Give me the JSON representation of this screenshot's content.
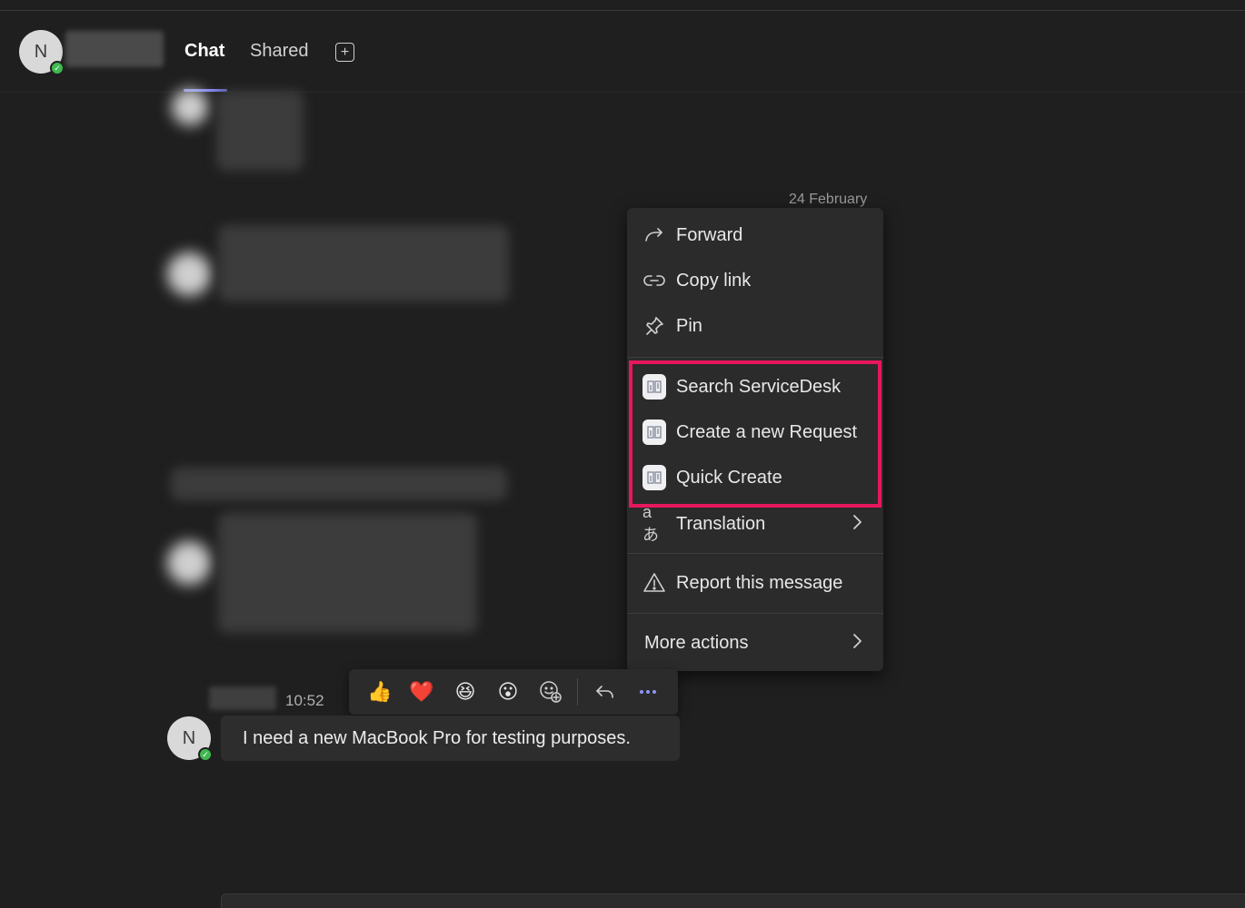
{
  "header": {
    "avatar_initial": "N",
    "tabs": [
      {
        "label": "Chat",
        "active": true
      },
      {
        "label": "Shared",
        "active": false
      }
    ],
    "add_tab_icon": "plus-square-icon"
  },
  "conversation": {
    "date_separator": "24 February",
    "message": {
      "avatar_initial": "N",
      "time": "10:52",
      "text": "I need a new MacBook Pro for testing purposes."
    }
  },
  "context_menu": {
    "items": [
      {
        "label": "Forward",
        "icon": "forward-arrow-icon"
      },
      {
        "label": "Copy link",
        "icon": "link-icon"
      },
      {
        "label": "Pin",
        "icon": "pin-icon"
      },
      {
        "label": "Search ServiceDesk",
        "icon": "servicedesk-app-icon"
      },
      {
        "label": "Create a new Request",
        "icon": "servicedesk-app-icon"
      },
      {
        "label": "Quick Create",
        "icon": "servicedesk-app-icon"
      },
      {
        "label": "Translation",
        "icon": "translate-icon",
        "submenu": true
      },
      {
        "label": "Report this message",
        "icon": "warning-icon"
      },
      {
        "label": "More actions",
        "submenu": true
      }
    ],
    "highlight_color": "#e8175d"
  },
  "reaction_bar": {
    "reactions": [
      "👍",
      "❤️",
      "😆",
      "😮"
    ],
    "icons": [
      "add-reaction-icon",
      "reply-icon",
      "more-icon"
    ]
  },
  "colors": {
    "background": "#1f1f1f",
    "menu": "#2b2b2b",
    "accent": "#7f85f5",
    "presence": "#3fb950"
  }
}
